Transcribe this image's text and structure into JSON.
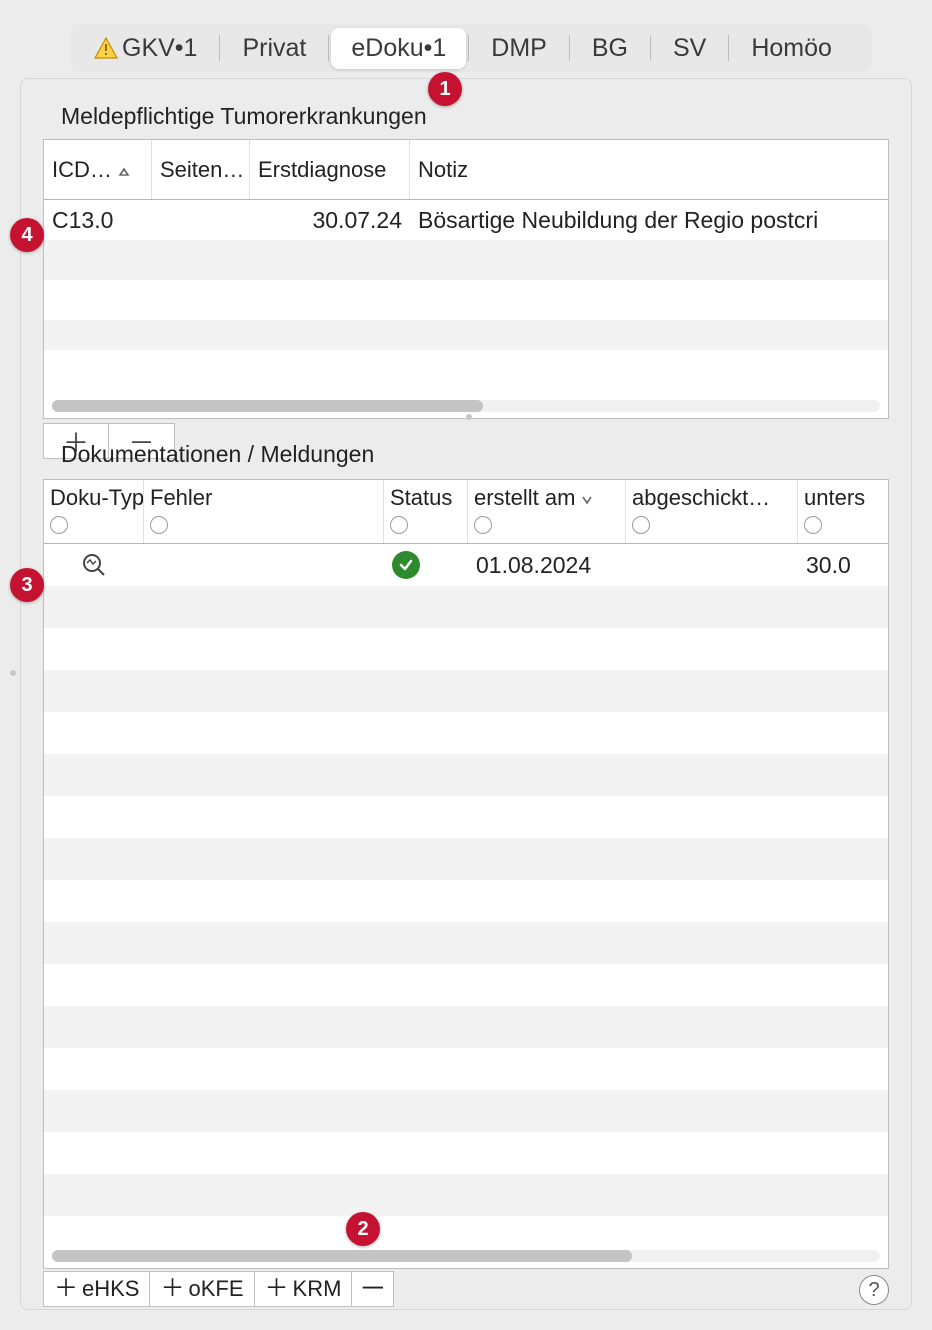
{
  "tabs": [
    {
      "label": "GKV•1",
      "warn": true
    },
    {
      "label": "Privat"
    },
    {
      "label": "eDoku•1",
      "active": true
    },
    {
      "label": "DMP"
    },
    {
      "label": "BG"
    },
    {
      "label": "SV"
    },
    {
      "label": "Homöo"
    }
  ],
  "tumor": {
    "title": "Meldepflichtige Tumorerkrankungen",
    "columns": {
      "icd": "ICD…",
      "seite": "Seiten…",
      "erst": "Erstdiagnose",
      "notiz": "Notiz"
    },
    "rows": [
      {
        "icd": "C13.0",
        "seite": "",
        "erst": "30.07.24",
        "notiz": "Bösartige Neubildung der Regio postcri"
      }
    ]
  },
  "doku": {
    "title": "Dokumentationen / Meldungen",
    "columns": {
      "typ": "Doku-Typ",
      "fehler": "Fehler",
      "status": "Status",
      "erstellt": "erstellt am",
      "abgeschickt": "abgeschickt…",
      "unters": "unters"
    },
    "rows": [
      {
        "typ_icon": "magnify",
        "fehler": "",
        "status": "ok",
        "erstellt": "01.08.2024",
        "abgeschickt": "",
        "unters": "30.0"
      }
    ]
  },
  "bottom_buttons": {
    "ehks": "eHKS",
    "okfe": "oKFE",
    "krm": "KRM"
  },
  "callouts": {
    "c1": "1",
    "c2": "2",
    "c3": "3",
    "c4": "4"
  }
}
